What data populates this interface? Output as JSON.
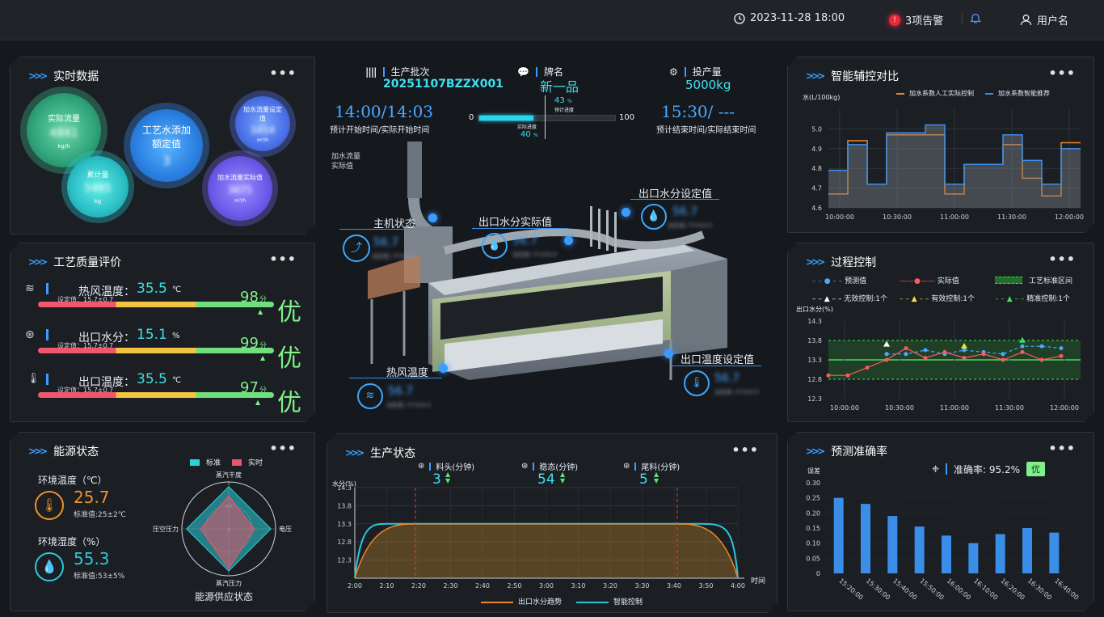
{
  "header": {
    "datetime": "2023-11-28   18:00",
    "alert_count": "3项告警",
    "username": "用户名"
  },
  "realtime": {
    "title": "实时数据",
    "bubbles": [
      {
        "label": "实际流量",
        "value": "4841",
        "unit": "kg/h"
      },
      {
        "label": "累计量",
        "value": "5485",
        "unit": "kg"
      },
      {
        "label": "工艺水添加额定值",
        "value": "3",
        "unit": ""
      },
      {
        "label": "加水流量设定值",
        "value": "3454",
        "unit": "m³/h"
      },
      {
        "label": "加水流量实际值",
        "value": "3675",
        "unit": "m³/h"
      }
    ]
  },
  "quality": {
    "title": "工艺质量评价",
    "rows": [
      {
        "label": "热风温度：",
        "value": "35.5",
        "unit": "℃",
        "setpoint": "设定值：15.7±0.7",
        "score": "98",
        "score_unit": "分",
        "grade": "优",
        "score_pct": 0.98
      },
      {
        "label": "出口水分：",
        "value": "15.1",
        "unit": "%",
        "setpoint": "设定值：15.7±0.7",
        "score": "99",
        "score_unit": "分",
        "grade": "优",
        "score_pct": 0.99
      },
      {
        "label": "出口温度：",
        "value": "35.5",
        "unit": "℃",
        "setpoint": "设定值：15.7±0.7",
        "score": "97",
        "score_unit": "分",
        "grade": "优",
        "score_pct": 0.97
      }
    ]
  },
  "energy": {
    "title": "能源状态",
    "temp_label": "环境温度（℃）",
    "temp_value": "25.7",
    "temp_std": "标准值:25±2℃",
    "hum_label": "环境湿度（%）",
    "hum_value": "55.3",
    "hum_std": "标准值:53±5%",
    "legend_std": "标准",
    "legend_actual": "实时",
    "axes": [
      "蒸汽干度",
      "电压",
      "蒸汽压力",
      "压空压力"
    ],
    "ticks": [
      "1",
      "0.5",
      "0"
    ],
    "std_values": [
      0.9,
      0.9,
      0.9,
      0.9
    ],
    "actual_values": [
      0.7,
      0.55,
      0.85,
      0.6
    ],
    "caption": "能源供应状态"
  },
  "center": {
    "batch_label": "生产批次",
    "batch_value": "20251107BZZX001",
    "brand_label": "牌名",
    "brand_value": "新一品",
    "output_label": "投产量",
    "output_value": "5000kg",
    "start_time": "14:00",
    "start_actual": "14:03",
    "start_caption": "预计开始时间/实际开始时间",
    "end_time": "15:30",
    "end_actual": "---",
    "end_caption": "预计结束时间/实际结束时间",
    "progress_min": "0",
    "progress_max": "100",
    "planned_pct": "43",
    "planned_label": "预计进度",
    "actual_pct": "40",
    "actual_label": "实际进度",
    "pct_unit": "%",
    "water_flow_label": "加水流量\n实际值",
    "callouts": [
      {
        "label": "主机状态",
        "value": "56.7",
        "sub": "设定值 / P-XXX-X"
      },
      {
        "label": "出口水分实际值",
        "value": "56.7",
        "sub": "设定值 / P-XXX-X"
      },
      {
        "label": "出口水分设定值",
        "value": "56.7",
        "sub": "设定值 / P-XXX-X"
      },
      {
        "label": "热风温度",
        "value": "56.7",
        "sub": "设定值 / P-XXX-X"
      },
      {
        "label": "出口温度设定值",
        "value": "56.7",
        "sub": "设定值 / P-XXX-X"
      }
    ]
  },
  "production": {
    "title": "生产状态",
    "stats": [
      {
        "label": "料头(分钟)",
        "value": "3"
      },
      {
        "label": "稳态(分钟)",
        "value": "54"
      },
      {
        "label": "尾料(分钟)",
        "value": "5"
      }
    ],
    "ylabel": "水分(%)",
    "xlabel": "时间",
    "legend": [
      "出口水分趋势",
      "智能控制"
    ]
  },
  "smart_compare": {
    "title": "智能辅控对比",
    "ylabel": "水(L/100kg)",
    "legend": [
      "加水系数人工实际控制",
      "加水系数智能推荐"
    ]
  },
  "process": {
    "title": "过程控制",
    "legend": [
      "预测值",
      "实际值",
      "工艺标准区间",
      "无效控制:1个",
      "有效控制:1个",
      "精准控制:1个"
    ],
    "ylabel": "出口水分(%)"
  },
  "accuracy": {
    "title": "预测准确率",
    "ylabel": "误差",
    "accuracy_text": "准确率: 95.2%",
    "grade": "优"
  },
  "chart_data": [
    {
      "type": "line",
      "title": "",
      "ylabel": "水(L/100kg)",
      "x": [
        "10:00:00",
        "10:10:00",
        "10:20:00",
        "10:30:00",
        "10:40:00",
        "10:50:00",
        "11:00:00",
        "11:10:00",
        "11:20:00",
        "11:30:00",
        "11:40:00",
        "11:50:00",
        "12:00:00",
        "12:10:00"
      ],
      "ylim": [
        4.6,
        5.1
      ],
      "yticks": [
        "5.0",
        "4.9",
        "4.8",
        "4.7",
        "4.6"
      ],
      "xticks": [
        "10:00:00",
        "10:30:00",
        "11:00:00",
        "11:30:00",
        "12:00:00"
      ],
      "series": [
        {
          "name": "加水系数人工实际控制",
          "color": "#f0862a",
          "values": [
            4.67,
            4.94,
            4.72,
            4.97,
            4.97,
            4.97,
            4.67,
            4.82,
            4.82,
            4.92,
            4.75,
            4.66,
            4.93,
            4.93
          ]
        },
        {
          "name": "加水系数智能推荐",
          "color": "#3c8ee8",
          "values": [
            4.79,
            4.92,
            4.72,
            4.98,
            4.98,
            5.02,
            4.72,
            4.82,
            4.82,
            4.97,
            4.84,
            4.72,
            4.9,
            4.9
          ]
        }
      ]
    },
    {
      "type": "line",
      "title": "",
      "ylabel": "出口水分(%)",
      "x": [
        "10:00",
        "10:10",
        "10:20",
        "10:30",
        "10:40",
        "10:50",
        "11:00",
        "11:10",
        "11:20",
        "11:30",
        "11:40",
        "11:50",
        "12:00",
        "12:10"
      ],
      "xticks": [
        "10:00:00",
        "10:30:00",
        "11:00:00",
        "11:30:00",
        "12:00:00"
      ],
      "ylim": [
        12.3,
        14.3
      ],
      "yticks": [
        "14.3",
        "13.8",
        "13.3",
        "12.8",
        "12.3"
      ],
      "band": [
        12.8,
        13.8
      ],
      "series": [
        {
          "name": "预测值",
          "color": "#4aa8ff",
          "values": [
            null,
            null,
            null,
            13.45,
            13.45,
            13.55,
            13.45,
            13.55,
            13.5,
            13.45,
            13.65,
            13.65,
            13.6,
            null
          ]
        },
        {
          "name": "实际值",
          "color": "#ff5a5a",
          "values": [
            12.9,
            12.9,
            13.1,
            13.3,
            13.6,
            13.35,
            13.5,
            13.35,
            13.45,
            13.3,
            13.5,
            13.3,
            13.4,
            null
          ]
        }
      ]
    },
    {
      "type": "area",
      "title": "",
      "ylabel": "水分(%)",
      "xlabel": "时间",
      "x": [
        "2:00",
        "2:10",
        "2:20",
        "2:30",
        "2:40",
        "2:50",
        "3:00",
        "3:10",
        "3:20",
        "3:30",
        "3:40",
        "3:50",
        "4:00"
      ],
      "ylim": [
        11.8,
        14.3
      ],
      "yticks": [
        "14.3",
        "13.8",
        "13.3",
        "12.8",
        "12.3"
      ],
      "series": [
        {
          "name": "出口水分趋势",
          "color": "#f0862a",
          "values": [
            11.8,
            13.3,
            13.3,
            13.3,
            13.3,
            13.3,
            13.3,
            13.3,
            13.3,
            13.3,
            13.3,
            13.3,
            11.8
          ]
        },
        {
          "name": "智能控制",
          "color": "#29c7d8",
          "values": [
            11.8,
            13.3,
            13.3,
            13.3,
            13.3,
            13.3,
            13.3,
            13.3,
            13.3,
            13.3,
            13.3,
            13.3,
            11.8
          ]
        }
      ]
    },
    {
      "type": "bar",
      "title": "",
      "ylabel": "误差",
      "categories": [
        "15:20:00",
        "15:30:00",
        "15:40:00",
        "15:50:00",
        "16:00:00",
        "16:10:00",
        "16:20:00",
        "16:30:00",
        "16:40:00"
      ],
      "values": [
        0.25,
        0.23,
        0.19,
        0.155,
        0.125,
        0.1,
        0.13,
        0.15,
        0.135
      ],
      "ylim": [
        0,
        0.3
      ],
      "yticks": [
        "0.30",
        "0.25",
        "0.20",
        "0.15",
        "0.10",
        "0.05",
        "0"
      ]
    }
  ]
}
